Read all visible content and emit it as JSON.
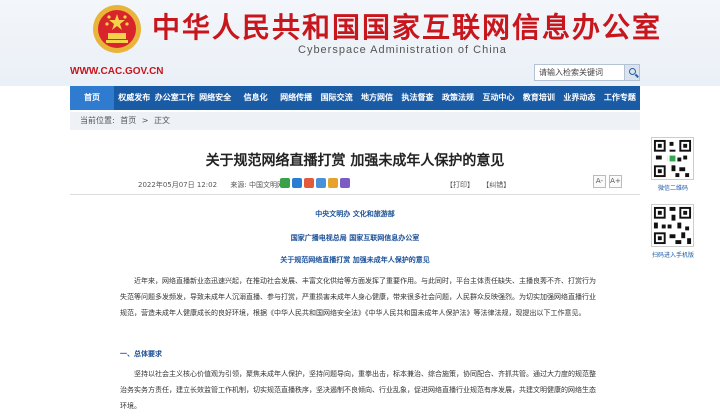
{
  "header": {
    "title": "中华人民共和国国家互联网信息办公室",
    "subtitle": "Cyberspace Administration of China",
    "url": "WWW.CAC.GOV.CN",
    "search_placeholder": "请输入检索关键词",
    "colors": {
      "brand_red": "#c8161d",
      "nav_blue": "#1a5ba6"
    }
  },
  "nav": {
    "items": [
      {
        "label": "首页"
      },
      {
        "label": "权威发布"
      },
      {
        "label": "办公室工作"
      },
      {
        "label": "网络安全"
      },
      {
        "label": "信息化"
      },
      {
        "label": "网络传播"
      },
      {
        "label": "国际交流"
      },
      {
        "label": "地方网信"
      },
      {
        "label": "执法督查"
      },
      {
        "label": "政策法规"
      },
      {
        "label": "互动中心"
      },
      {
        "label": "教育培训"
      },
      {
        "label": "业界动态"
      },
      {
        "label": "工作专题"
      }
    ]
  },
  "breadcrumb": {
    "prefix": "当前位置:",
    "home": "首页",
    "sep": ">",
    "current": "正文"
  },
  "article": {
    "title": "关于规范网络直播打赏 加强未成年人保护的意见",
    "date": "2022年05月07日 12:02",
    "source_label": "来源:",
    "source": "中国文明网",
    "print_label": "【打印】",
    "error_label": "【纠错】",
    "font_small": "A-",
    "font_large": "A+",
    "issuer1": "中央文明办 文化和旅游部",
    "issuer2": "国家广播电视总局 国家互联网信息办公室",
    "subtitle": "关于规范网络直播打赏 加强未成年人保护的意见",
    "para1": "近年来，网络直播新业态迅速兴起，在推动社会发展、丰富文化供给等方面发挥了重要作用。与此同时，平台主体责任缺失、主播良莠不齐、打赏行为失范等问题多发频发，导致未成年人沉溺直播、参与打赏，严重损害未成年人身心健康，带来很多社会问题，人民群众反映强烈。为切实加强网络直播行业规范，营造未成年人健康成长的良好环境，根据《中华人民共和国网络安全法》《中华人民共和国未成年人保护法》等法律法规，现提出以下工作意见。",
    "section1": "一、总体要求",
    "para2": "坚持以社会主义核心价值观为引领，聚焦未成年人保护，坚持问题导向，重拳出击，标本兼治、综合施策，协同配合、齐抓共管。通过大力度的规范整治务实务方责任，建立长效监管工作机制，切实规范直播秩序，坚决遏制不良倾向、行业乱象，促进网络直播行业规范有序发展，共建文明健康的网络生态环境。"
  },
  "sidebar": {
    "qr1_label": "微信二维码",
    "qr2_label": "扫码进入手机版"
  }
}
